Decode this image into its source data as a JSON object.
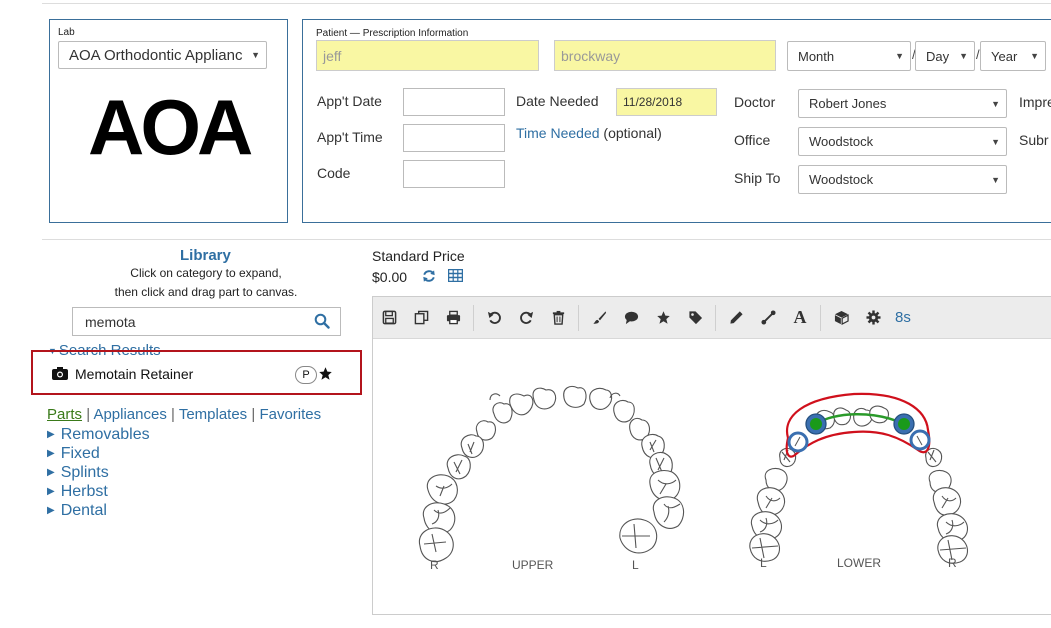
{
  "lab": {
    "legend": "Lab",
    "selected": "AOA Orthodontic Applianc",
    "logo_text": "AOA"
  },
  "patient": {
    "legend": "Patient — Prescription Information",
    "first_name": "jeff",
    "last_name": "brockway",
    "dob_month": "Month",
    "dob_day": "Day",
    "dob_year": "Year",
    "slash": "/",
    "appt_date_label": "App't Date",
    "appt_time_label": "App't Time",
    "code_label": "Code",
    "date_needed_label": "Date Needed",
    "date_needed_value": "11/28/2018",
    "time_needed_label": "Time Needed",
    "optional_label": "(optional)",
    "doctor_label": "Doctor",
    "doctor_value": "Robert Jones",
    "office_label": "Office",
    "office_value": "Woodstock",
    "ship_to_label": "Ship To",
    "ship_to_value": "Woodstock",
    "impr_label": "Impre",
    "subm_label": "Subr"
  },
  "library": {
    "title": "Library",
    "hint_line1": "Click on category to expand,",
    "hint_line2": "then click and drag part to canvas.",
    "search_value": "memota",
    "search_results_label": "Search Results",
    "result_name": "Memotain Retainer",
    "result_badge": "P",
    "tabs": [
      "Parts",
      "Appliances",
      "Templates",
      "Favorites"
    ],
    "tab_sep": "|",
    "categories": [
      "Removables",
      "Fixed",
      "Splints",
      "Herbst",
      "Dental"
    ]
  },
  "price": {
    "label": "Standard Price",
    "value": "$0.00"
  },
  "toolbar": {
    "timer": "8s"
  },
  "canvas": {
    "upper_label": "UPPER",
    "upper_left": "R",
    "upper_right": "L",
    "lower_label": "LOWER",
    "lower_left": "L",
    "lower_right": "R"
  },
  "colors": {
    "accent": "#2f6fa3",
    "highlight_red": "#c0151e",
    "field_yellow": "#f9f7a3",
    "retainer_red": "#d0101c",
    "wire_green": "#2a9a2a",
    "band_blue": "#3a6fb0"
  }
}
